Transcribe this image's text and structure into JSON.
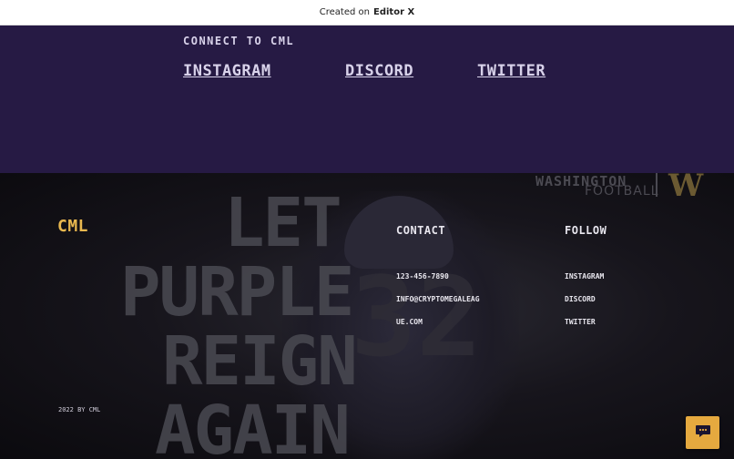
{
  "topbar": {
    "prefix": "Created on",
    "brand": "Editor X"
  },
  "connect": {
    "title": "CONNECT TO CML",
    "links": [
      "INSTAGRAM",
      "DISCORD",
      "TWITTER"
    ]
  },
  "footer": {
    "logo": "CML",
    "contact": {
      "title": "CONTACT",
      "phone": "123-456-7890",
      "email_line1": "INFO@CRYPTOMEGALEAG",
      "email_line2": "UE.COM"
    },
    "follow": {
      "title": "FOLLOW",
      "links": [
        "INSTAGRAM",
        "DISCORD",
        "TWITTER"
      ]
    },
    "copyright": "2022 BY CML"
  },
  "background": {
    "slogan": [
      "LET",
      "PURPLE",
      "REIGN",
      "AGAIN"
    ],
    "jersey_number": "32",
    "team_name": "WASHINGTON",
    "team_sub": "FOOTBALL",
    "team_logo": "W"
  },
  "chat": {
    "icon": "chat-bubble-icon"
  },
  "colors": {
    "connect_bg": "#261a44",
    "accent": "#e9b84f",
    "chat_bg": "#e5a93f"
  }
}
